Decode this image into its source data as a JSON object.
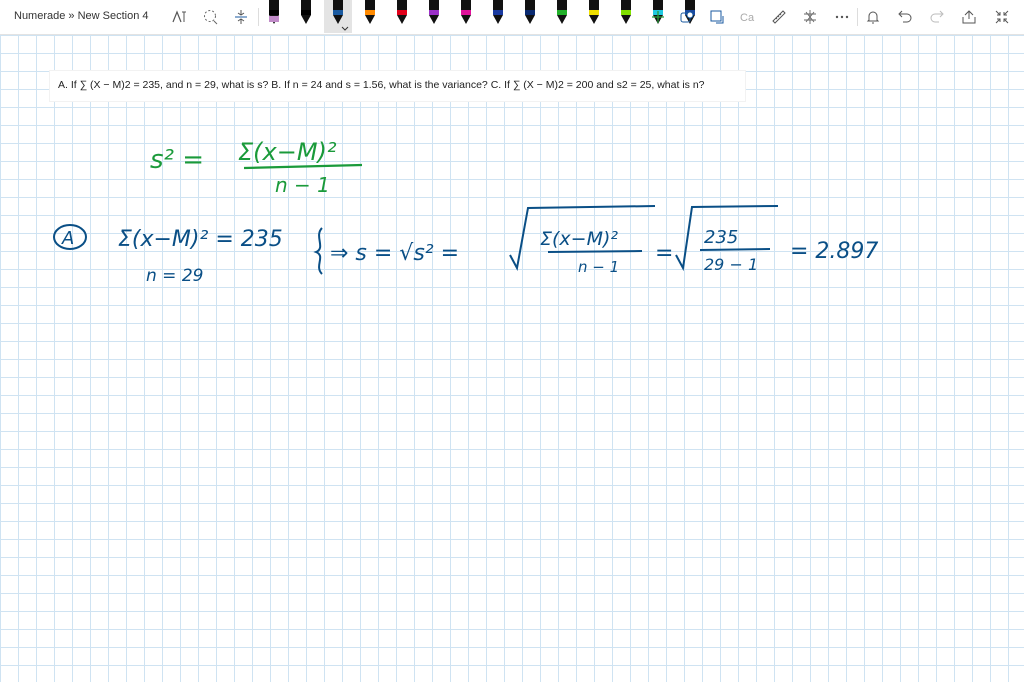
{
  "breadcrumb": "Numerade » New Section 4",
  "question": "A. If ∑ (X − M)2 = 235, and n = 29, what is s? B. If n = 24 and s = 1.56, what is the variance? C. If ∑ (X − M)2 = 200 and s2 = 25, what is n?",
  "colors": {
    "grid": "#cfe3f2",
    "green_ink": "#1a9a3a",
    "blue_ink": "#0a4f86"
  },
  "pens": [
    {
      "name": "black",
      "tip": "#000000",
      "band": "#c08ac8"
    },
    {
      "name": "black",
      "tip": "#000000",
      "band": "#000000"
    },
    {
      "name": "blue-selected",
      "tip": "#1a5aa0",
      "band": "#000000"
    },
    {
      "name": "orange",
      "tip": "#ff8a00",
      "band": "#000000"
    },
    {
      "name": "red",
      "tip": "#e0001a",
      "band": "#000000"
    },
    {
      "name": "purple",
      "tip": "#9b30c8",
      "band": "#000000"
    },
    {
      "name": "magenta",
      "tip": "#e0109a",
      "band": "#000000"
    },
    {
      "name": "dark-blue",
      "tip": "#1a3aa0",
      "band": "#000000"
    },
    {
      "name": "navy",
      "tip": "#0a2a70",
      "band": "#000000"
    },
    {
      "name": "green",
      "tip": "#22b02a",
      "band": "#000000"
    },
    {
      "name": "yellow",
      "tip": "#f0e000",
      "band": "#000000"
    },
    {
      "name": "lime",
      "tip": "#80e000",
      "band": "#000000"
    },
    {
      "name": "cyan",
      "tip": "#20c8e0",
      "band": "#000000"
    },
    {
      "name": "dark-blue-2",
      "tip": "#1a4aa0",
      "band": "#000000"
    }
  ],
  "handwriting": {
    "formula_lhs": "s² =",
    "formula_num": "Σ(x−M)²",
    "formula_den": "n − 1",
    "part_label": "A",
    "given_sum": "Σ(x−M)² = 235",
    "given_n": "n = 29",
    "step1": "⇒ s = √s² =",
    "step2_num": "Σ(x−M)²",
    "step2_den": "n − 1",
    "step3_num": "235",
    "step3_den": "29 − 1",
    "result": "= 2.897"
  }
}
